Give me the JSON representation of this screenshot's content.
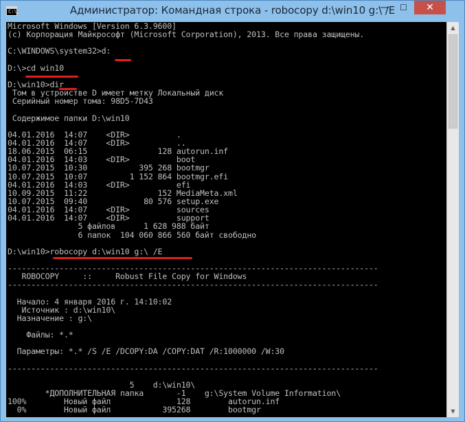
{
  "window": {
    "title": "Администратор: Командная строка - robocopy  d:\\win10 g:\\ /E",
    "icon": "cmd-icon",
    "icon_glyph": "C:\\",
    "buttons": {
      "minimize": "—",
      "maximize": "☐",
      "close": "✕"
    }
  },
  "console": {
    "lines": [
      "Microsoft Windows [Version 6.3.9600]",
      "(c) Корпорация Майкрософт (Microsoft Corporation), 2013. Все права защищены.",
      "",
      "C:\\WINDOWS\\system32>d:",
      "",
      "D:\\>cd win10",
      "",
      "D:\\win10>dir",
      " Том в устройстве D имеет метку Локальный диск",
      " Серийный номер тома: 98D5-7D43",
      "",
      " Содержимое папки D:\\win10",
      "",
      "04.01.2016  14:07    <DIR>          .",
      "04.01.2016  14:07    <DIR>          ..",
      "18.06.2015  06:15               128 autorun.inf",
      "04.01.2016  14:03    <DIR>          boot",
      "10.07.2015  10:30           395 268 bootmgr",
      "10.07.2015  10:07         1 152 864 bootmgr.efi",
      "04.01.2016  14:03    <DIR>          efi",
      "10.09.2015  11:22               152 MediaMeta.xml",
      "10.07.2015  09:40            80 576 setup.exe",
      "04.01.2016  14:07    <DIR>          sources",
      "04.01.2016  14:07    <DIR>          support",
      "               5 файлов      1 628 988 байт",
      "               6 папок  104 060 866 560 байт свободно",
      "",
      "D:\\win10>robocopy d:\\win10 g:\\ /E",
      "",
      "-------------------------------------------------------------------------------",
      "   ROBOCOPY     ::     Robust File Copy for Windows",
      "-------------------------------------------------------------------------------",
      "",
      "  Начало: 4 января 2016 г. 14:10:02",
      "   Источник : d:\\win10\\",
      "  Назначение : g:\\",
      "",
      "    Файлы: *.*",
      "",
      "  Параметры: *.* /S /E /DCOPY:DA /COPY:DAT /R:1000000 /W:30",
      "",
      "-------------------------------------------------------------------------------",
      "",
      "                          5    d:\\win10\\",
      "        *ДОПОЛНИТЕЛЬНАЯ папка       -1    g:\\System Volume Information\\",
      "100%        Новый файл              128        autorun.inf",
      "  0%        Новый файл           395268        bootmgr"
    ]
  },
  "annotation_color": "#e01f1f",
  "scrollbar": {
    "up": "▲",
    "down": "▼"
  }
}
